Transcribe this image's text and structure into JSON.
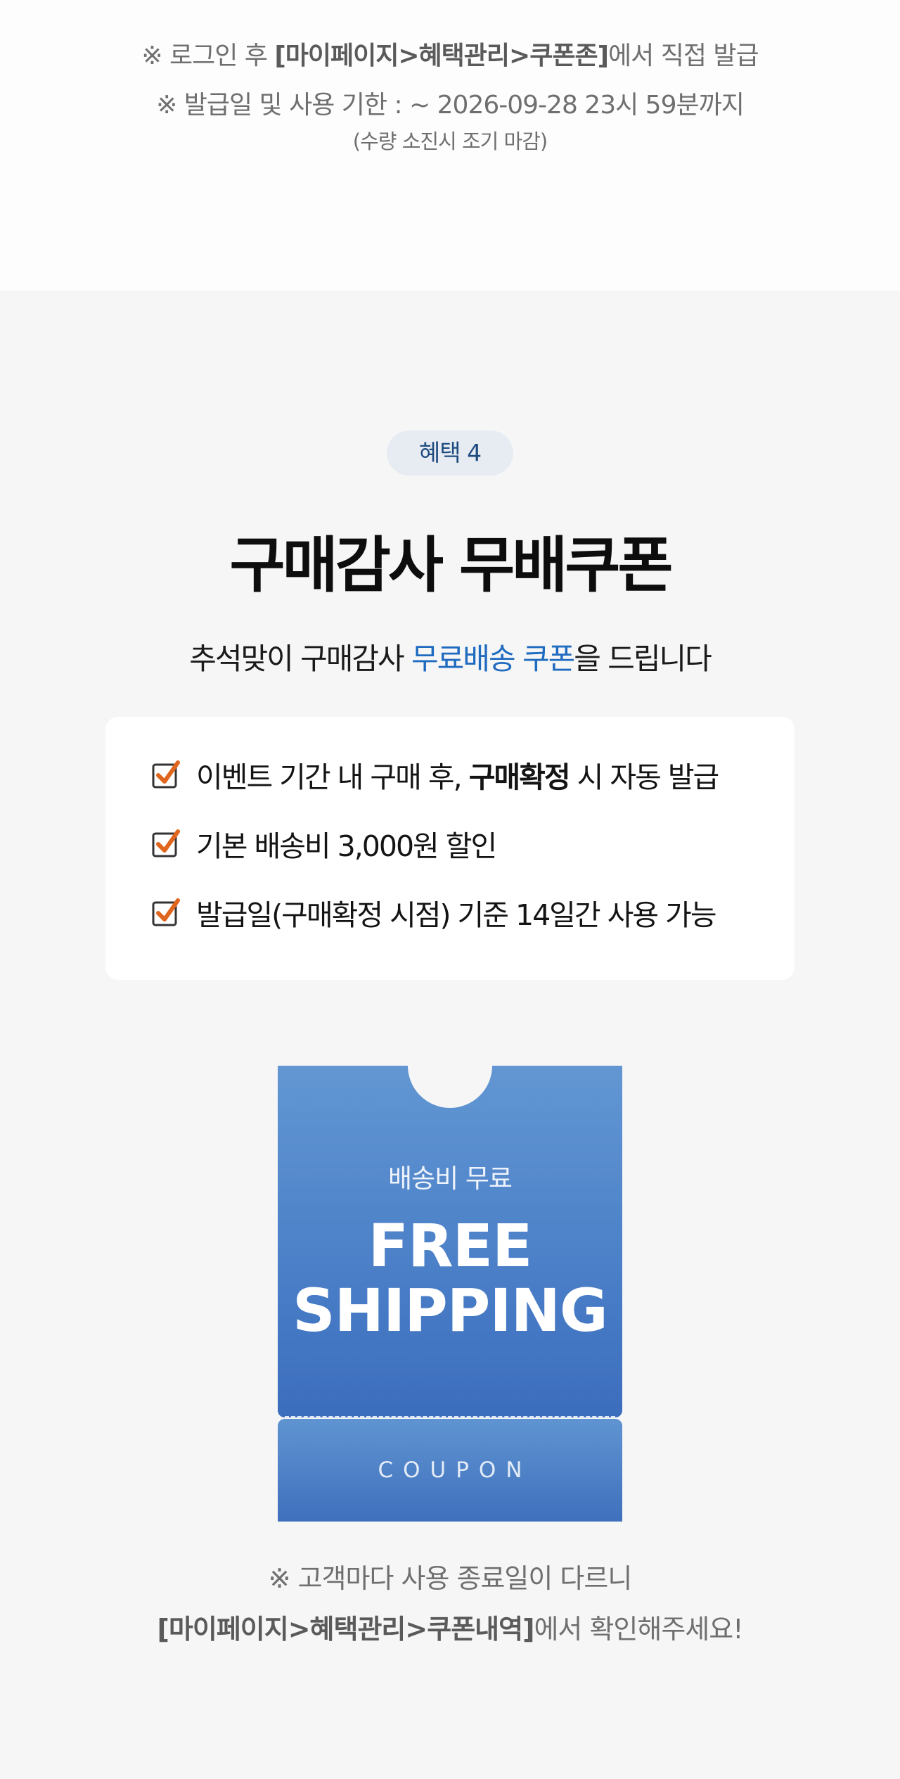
{
  "top_notice": {
    "line1_prefix": "※ 로그인 후 ",
    "line1_path": "[마이페이지>혜택관리>쿠폰존]",
    "line1_suffix": "에서 직접 발급",
    "line2": "※ 발급일 및 사용 기한 : ~ 2026-09-28 23시 59분까지",
    "line3": "(수량 소진시 조기 마감)"
  },
  "benefit": {
    "badge": "혜택 4",
    "title": "구매감사 무배쿠폰",
    "subtitle_prefix": "추석맞이 구매감사 ",
    "subtitle_highlight": "무료배송 쿠폰",
    "subtitle_suffix": "을 드립니다",
    "items": [
      {
        "text_plain": "이벤트 기간 내 구매 후, ",
        "text_bold": "구매확정",
        "text_rest": " 시 자동 발급"
      },
      {
        "text_plain": "기본 배송비 3,000원 할인",
        "text_bold": "",
        "text_rest": ""
      },
      {
        "text_plain": "발급일(구매확정 시점) 기준 14일간 사용 가능",
        "text_bold": "",
        "text_rest": ""
      }
    ],
    "check_icon": "check-icon",
    "colors": {
      "highlight": "#1f6bc0",
      "check": "#e0651d",
      "coupon": "#4a7ec7"
    }
  },
  "coupon": {
    "small_label": "배송비 무료",
    "big_line1": "FREE",
    "big_line2": "SHIPPING",
    "stub_label": "COUPON"
  },
  "bottom_note": {
    "line1": "※ 고객마다 사용 종료일이 다르니",
    "line2_path": "[마이페이지>혜택관리>쿠폰내역]",
    "line2_suffix": "에서 확인해주세요!"
  }
}
